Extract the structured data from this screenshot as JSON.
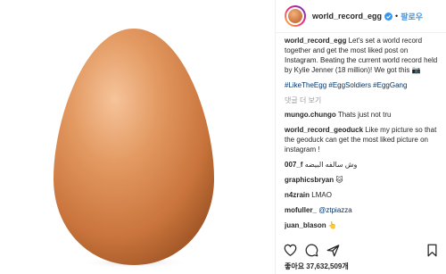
{
  "header": {
    "username": "world_record_egg",
    "follow_label": "팔로우",
    "separator": "•"
  },
  "caption": {
    "username": "world_record_egg",
    "text": "Let's set a world record together and get the most liked post on Instagram. Beating the current world record held by Kylie Jenner (18 million)! We got this 📷",
    "hashtags": "#LikeTheEgg #EggSoldiers #EggGang"
  },
  "more_comments_label": "댓글 더 보기",
  "comments": [
    {
      "username": "mungo.chungo",
      "text": "Thats just not tru"
    },
    {
      "username": "world_record_geoduck",
      "text": "Like my picture so that the geoduck can get the most liked picture on instagram !"
    },
    {
      "username": "007_f",
      "text": "وش سالفه البيضه"
    },
    {
      "username": "graphicsbryan",
      "text": "🐱"
    },
    {
      "username": "n4zrain",
      "text": "LMAO"
    },
    {
      "username": "mofuller_",
      "text": "@ztpiazza"
    },
    {
      "username": "juan_blason",
      "text": "👆"
    }
  ],
  "likes_text": "좋아요 37,632,509개",
  "icons": [
    "heart-icon",
    "comment-icon",
    "share-icon",
    "bookmark-icon",
    "verified-badge-icon"
  ],
  "colors": {
    "accent": "#3897f0",
    "egg": "#d98a52",
    "background": "#ffffff"
  }
}
